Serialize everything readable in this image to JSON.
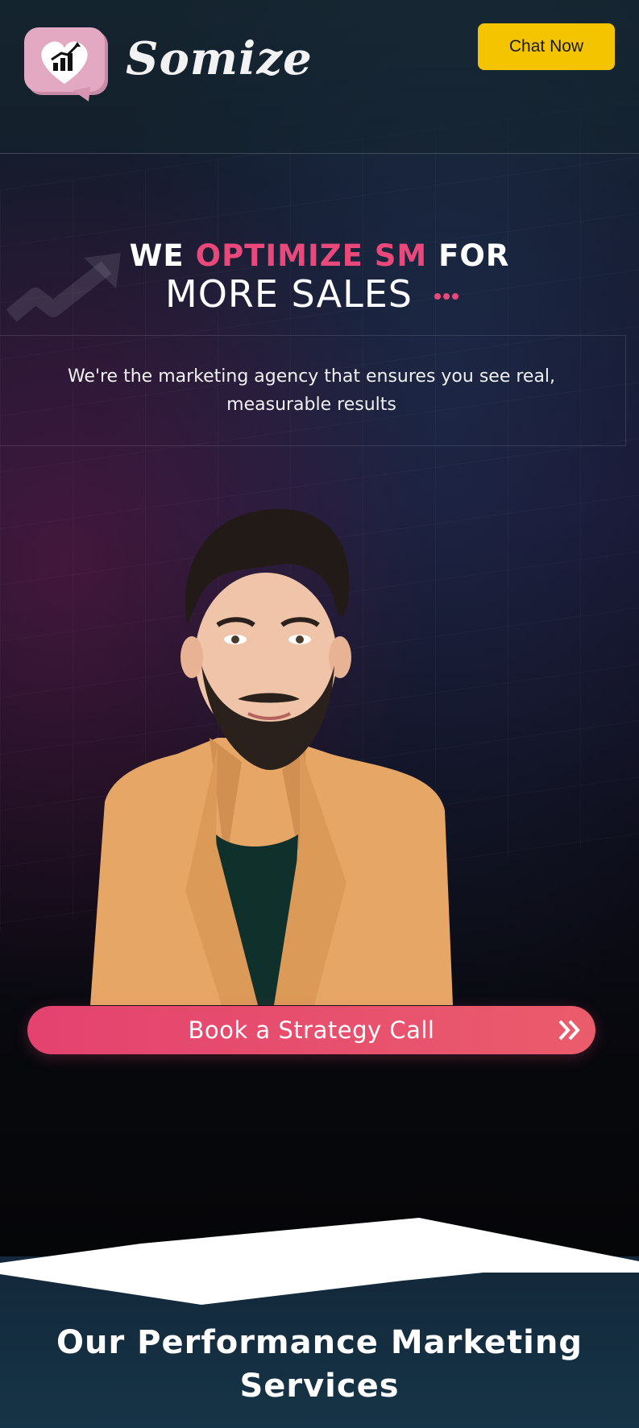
{
  "header": {
    "brand": "Somize",
    "chat_button": "Chat Now"
  },
  "hero": {
    "headline_we": "WE",
    "headline_highlight": "OPTIMIZE SM",
    "headline_for": "FOR",
    "headline_line2": "MORE SALES",
    "subtitle": "We're the marketing agency that ensures you see real, measurable results",
    "cta_label": "Book a Strategy Call"
  },
  "services": {
    "title": "Our Performance Marketing Services"
  },
  "colors": {
    "accent_pink": "#e8497a",
    "button_yellow": "#f5c400",
    "dark_bg": "#0d1620"
  },
  "icons": [
    "logo-badge-icon",
    "trend-arrow-icon",
    "dots-icon",
    "double-chevron-right-icon"
  ]
}
